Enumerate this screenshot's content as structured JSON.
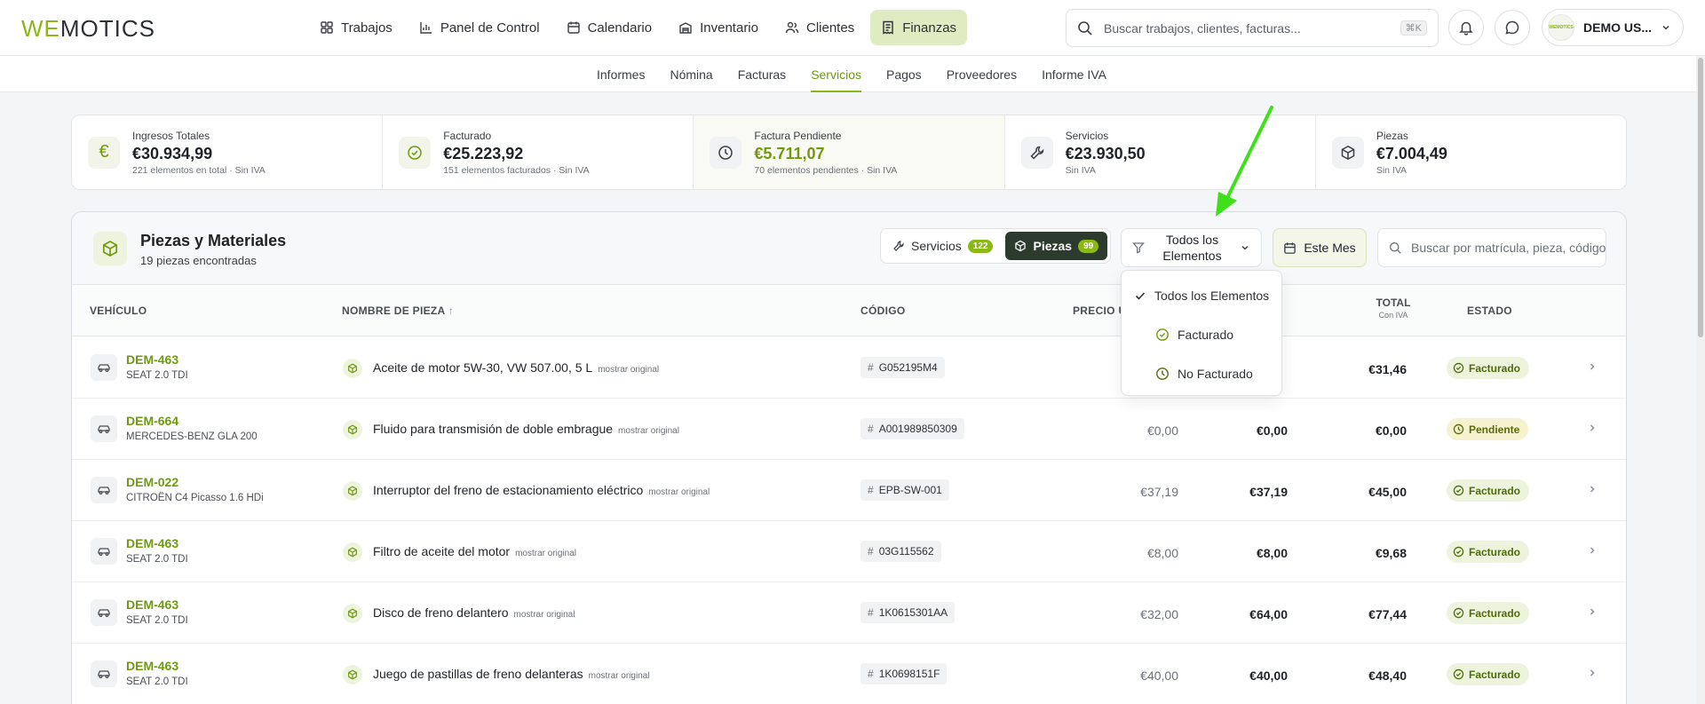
{
  "brand": {
    "logo_we": "WE",
    "logo_rest": "MOTICS"
  },
  "mainnav": {
    "items": [
      {
        "label": "Trabajos",
        "icon": "grid-icon"
      },
      {
        "label": "Panel de Control",
        "icon": "bar-chart-icon"
      },
      {
        "label": "Calendario",
        "icon": "calendar-icon"
      },
      {
        "label": "Inventario",
        "icon": "warehouse-icon"
      },
      {
        "label": "Clientes",
        "icon": "users-icon"
      },
      {
        "label": "Finanzas",
        "icon": "receipt-icon",
        "active": true
      }
    ]
  },
  "search": {
    "placeholder": "Buscar trabajos, clientes, facturas...",
    "shortcut": "⌘K"
  },
  "user": {
    "name": "DEMO US...",
    "avatar_text": "WEMOTICS"
  },
  "subnav": {
    "items": [
      "Informes",
      "Nómina",
      "Facturas",
      "Servicios",
      "Pagos",
      "Proveedores",
      "Informe IVA"
    ],
    "active": "Servicios"
  },
  "stats": [
    {
      "label": "Ingresos Totales",
      "value": "€30.934,99",
      "sub": "221 elementos en total · Sin IVA",
      "icon": "euro-icon"
    },
    {
      "label": "Facturado",
      "value": "€25.223,92",
      "sub": "151 elementos facturados · Sin IVA",
      "icon": "check-circle-icon"
    },
    {
      "label": "Factura Pendiente",
      "value": "€5.711,07",
      "sub": "70 elementos pendientes · Sin IVA",
      "icon": "clock-icon"
    },
    {
      "label": "Servicios",
      "value": "€23.930,50",
      "sub": "Sin IVA",
      "icon": "wrench-icon"
    },
    {
      "label": "Piezas",
      "value": "€7.004,49",
      "sub": "Sin IVA",
      "icon": "box-icon"
    }
  ],
  "card": {
    "title": "Piezas y Materiales",
    "subtitle": "19 piezas encontradas",
    "seg_servicios": "Servicios",
    "seg_servicios_count": "122",
    "seg_piezas": "Piezas",
    "seg_piezas_count": "99",
    "filter_label_1": "Todos los",
    "filter_label_2": "Elementos",
    "date_label": "Este Mes",
    "search_placeholder": "Buscar por matrícula, pieza, código"
  },
  "columns": {
    "vehiculo": "VEHÍCULO",
    "nombre": "NOMBRE DE PIEZA",
    "codigo": "CÓDIGO",
    "precio": "PRECIO U",
    "total": "TOTAL",
    "total_sub": "Con IVA",
    "estado": "ESTADO"
  },
  "rows": [
    {
      "plate": "DEM-463",
      "model": "SEAT 2.0 TDI",
      "name": "Aceite de motor 5W-30, VW 507.00, 5 L",
      "orig": "mostrar original",
      "code": "G052195M4",
      "price": "",
      "subtotal": "",
      "total": "€31,46",
      "status": "Facturado"
    },
    {
      "plate": "DEM-664",
      "model": "MERCEDES-BENZ GLA 200",
      "name": "Fluido para transmisión de doble embrague",
      "orig": "mostrar original",
      "code": "A001989850309",
      "price": "€0,00",
      "subtotal": "€0,00",
      "total": "€0,00",
      "status": "Pendiente"
    },
    {
      "plate": "DEM-022",
      "model": "CITROËN C4 Picasso 1.6 HDi",
      "name": "Interruptor del freno de estacionamiento eléctrico",
      "orig": "mostrar original",
      "code": "EPB-SW-001",
      "price": "€37,19",
      "subtotal": "€37,19",
      "total": "€45,00",
      "status": "Facturado"
    },
    {
      "plate": "DEM-463",
      "model": "SEAT 2.0 TDI",
      "name": "Filtro de aceite del motor",
      "orig": "mostrar original",
      "code": "03G115562",
      "price": "€8,00",
      "subtotal": "€8,00",
      "total": "€9,68",
      "status": "Facturado"
    },
    {
      "plate": "DEM-463",
      "model": "SEAT 2.0 TDI",
      "name": "Disco de freno delantero",
      "orig": "mostrar original",
      "code": "1K0615301AA",
      "price": "€32,00",
      "subtotal": "€64,00",
      "total": "€77,44",
      "status": "Facturado"
    },
    {
      "plate": "DEM-463",
      "model": "SEAT 2.0 TDI",
      "name": "Juego de pastillas de freno delanteras",
      "orig": "mostrar original",
      "code": "1K0698151F",
      "price": "€40,00",
      "subtotal": "€40,00",
      "total": "€48,40",
      "status": "Facturado"
    }
  ],
  "dropdown": {
    "items": [
      {
        "label": "Todos los Elementos",
        "selected": true,
        "icon": "check-icon"
      },
      {
        "label": "Facturado",
        "icon": "check-circle-icon"
      },
      {
        "label": "No Facturado",
        "icon": "clock-icon"
      }
    ]
  },
  "colors": {
    "accent": "#8ab814",
    "accent_dark": "#6f9a0f",
    "arrow": "#3ee01a",
    "segment_active": "#2d3a2e"
  }
}
